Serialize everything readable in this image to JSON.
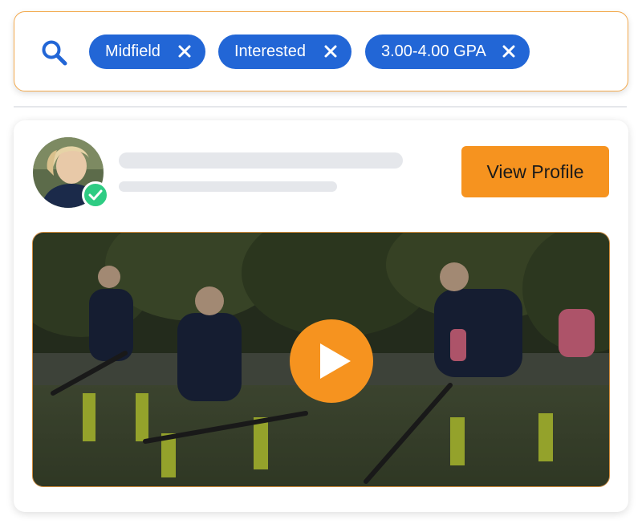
{
  "filters": {
    "chips": [
      {
        "label": "Midfield"
      },
      {
        "label": "Interested"
      },
      {
        "label": "3.00-4.00 GPA"
      }
    ]
  },
  "profile": {
    "view_profile_label": "View Profile",
    "verified": true
  },
  "icons": {
    "search": "search-icon",
    "remove": "close-icon",
    "verified": "check-icon",
    "play": "play-icon"
  },
  "colors": {
    "accent_blue": "#2266d6",
    "accent_orange": "#f6931f",
    "verified_green": "#2ecc83",
    "search_border": "#f3a94c"
  }
}
